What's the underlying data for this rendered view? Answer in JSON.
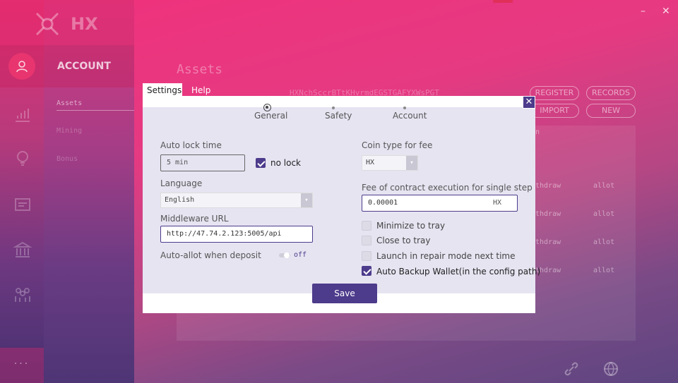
{
  "app": {
    "logo_text": "HX",
    "account_label": "ACCOUNT",
    "sub_items": [
      "Assets",
      "Mining",
      "Bonus"
    ],
    "more_label": "···",
    "page_title": "Assets",
    "address": "HXNchSccrBTtKHvrmdEGSTGAFYXWsPGT",
    "buttons": [
      "REGISTER",
      "RECORDS",
      "IMPORT",
      "NEW"
    ],
    "bg_header_fragment": "n",
    "rows": [
      {
        "a": "thdraw",
        "b": "allot"
      },
      {
        "a": "thdraw",
        "b": "allot"
      },
      {
        "a": "thdraw",
        "b": "allot"
      },
      {
        "a": "thdraw",
        "b": "allot"
      }
    ],
    "window_minimize": "–",
    "window_close": "✕"
  },
  "dialog": {
    "tabs": [
      "Settings",
      "Help"
    ],
    "close_glyph": "✕",
    "steps": [
      "General",
      "Safety",
      "Account"
    ],
    "auto_lock": {
      "label": "Auto lock time",
      "value": "5  min",
      "no_lock_label": "no lock",
      "no_lock_checked": true
    },
    "language": {
      "label": "Language",
      "value": "English"
    },
    "middleware": {
      "label": "Middleware URL",
      "value": "http://47.74.2.123:5005/api"
    },
    "auto_allot": {
      "label": "Auto-allot when deposit",
      "state": "off"
    },
    "coin_type": {
      "label": "Coin type for fee",
      "value": "HX"
    },
    "fee": {
      "label": "Fee of contract execution for single step",
      "value": "0.00001",
      "unit": "HX"
    },
    "checkboxes": [
      {
        "label": "Minimize to tray",
        "checked": false
      },
      {
        "label": "Close to tray",
        "checked": false
      },
      {
        "label": "Launch in repair mode next time",
        "checked": false
      },
      {
        "label": "Auto Backup Wallet(in the config path)",
        "checked": true
      }
    ],
    "save_label": "Save"
  },
  "colors": {
    "accent": "#4d3b8c",
    "brand_pink": "#f0317b"
  }
}
